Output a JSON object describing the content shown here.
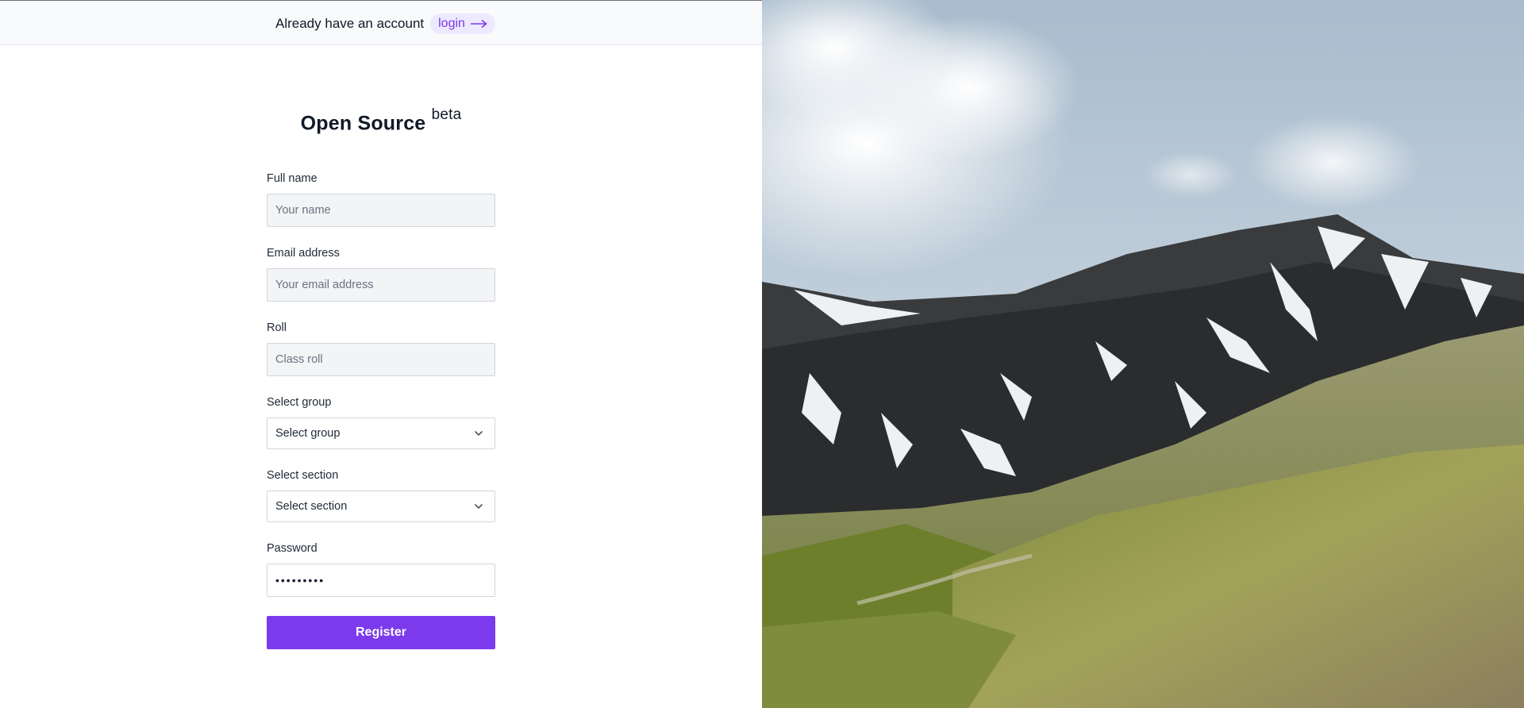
{
  "topbar": {
    "account_text": "Already have an account",
    "login_label": "login",
    "login_icon": "arrow-right-icon"
  },
  "brand": {
    "title": "Open Source",
    "badge": "beta"
  },
  "form": {
    "full_name": {
      "label": "Full name",
      "placeholder": "Your name",
      "value": ""
    },
    "email": {
      "label": "Email address",
      "placeholder": "Your email address",
      "value": ""
    },
    "roll": {
      "label": "Roll",
      "placeholder": "Class roll",
      "value": ""
    },
    "group": {
      "label": "Select group",
      "selected": "Select group",
      "icon": "chevron-down-icon"
    },
    "section": {
      "label": "Select section",
      "selected": "Select section",
      "icon": "chevron-down-icon"
    },
    "password": {
      "label": "Password",
      "value": "•••••••••"
    },
    "submit_label": "Register"
  },
  "colors": {
    "accent": "#7c3aed",
    "accent_soft": "#ede9fe",
    "input_bg": "#f3f4f6",
    "topbar_bg": "#f9fafb"
  },
  "hero_image": {
    "icon": "mountain-landscape-image"
  }
}
